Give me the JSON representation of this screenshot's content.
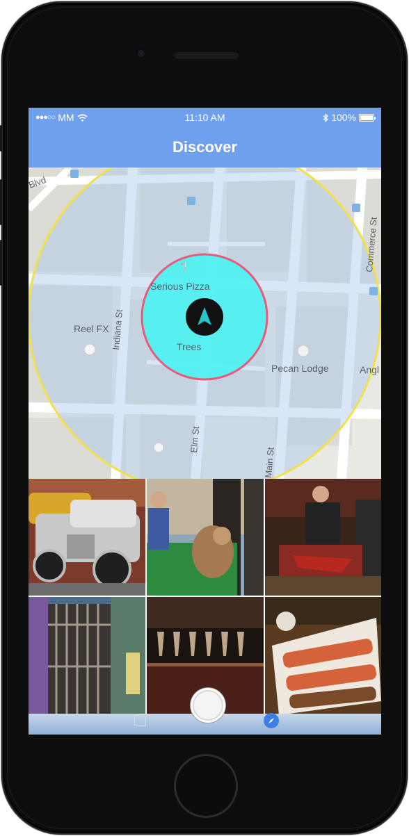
{
  "status_bar": {
    "signal": "●●●○○",
    "carrier": "MM",
    "time": "11:10 AM",
    "battery": "100%"
  },
  "header": {
    "title": "Discover"
  },
  "map": {
    "labels": {
      "serious_pizza": "Serious Pizza",
      "trees": "Trees",
      "reel_fx": "Reel FX",
      "pecan_lodge": "Pecan Lodge",
      "indiana_st": "Indiana St",
      "elm_st": "Elm St",
      "main_st": "Main St",
      "commerce_st": "Commerce St",
      "blvd": "Blvd",
      "angl": "Angl"
    },
    "colors": {
      "outer_ring": "#f2e04a",
      "inner_fill": "#4ef1f2",
      "inner_ring": "#e85a7a"
    }
  },
  "photos": [
    {
      "subject": "hot-rod-car"
    },
    {
      "subject": "owl-on-turf"
    },
    {
      "subject": "guitar-player"
    },
    {
      "subject": "graffiti-gate"
    },
    {
      "subject": "champagne-glasses"
    },
    {
      "subject": "sushi-rolls"
    }
  ],
  "icons": [
    "wifi-icon",
    "bluetooth-icon",
    "location-arrow-icon",
    "fork-knife-icon",
    "capture-button",
    "compass-icon",
    "contact-icon"
  ]
}
